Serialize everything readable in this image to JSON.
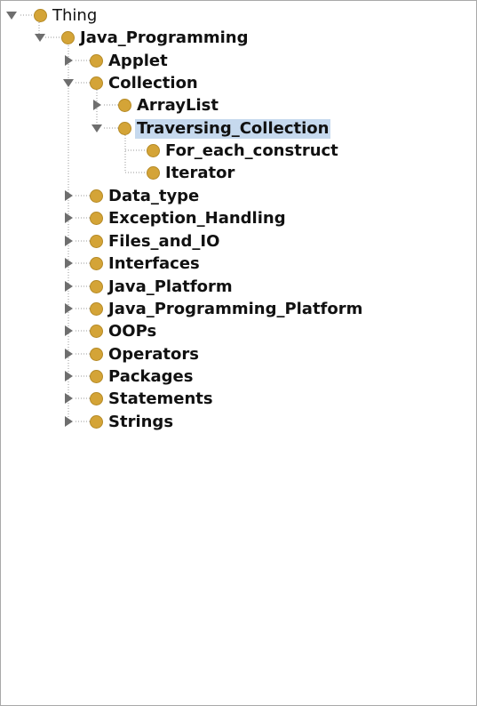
{
  "colors": {
    "class_bullet": "#d4a437",
    "selection_highlight": "#c6d9ee",
    "toggle_arrow": "#6e6e6e",
    "tree_line": "#9a9a9a"
  },
  "tree": {
    "root": {
      "label": "Thing",
      "state": "expanded",
      "icon": "class-bullet-icon"
    },
    "java_programming": {
      "label": "Java_Programming",
      "state": "expanded",
      "icon": "class-bullet-icon"
    },
    "applet": {
      "label": "Applet",
      "state": "collapsed",
      "icon": "class-bullet-icon"
    },
    "collection": {
      "label": "Collection",
      "state": "expanded",
      "icon": "class-bullet-icon"
    },
    "arraylist": {
      "label": "ArrayList",
      "state": "collapsed",
      "icon": "class-bullet-icon"
    },
    "traversing_collection": {
      "label": "Traversing_Collection",
      "state": "expanded",
      "selected": true,
      "icon": "class-bullet-icon"
    },
    "for_each_construct": {
      "label": "For_each_construct",
      "state": "leaf",
      "icon": "class-bullet-icon"
    },
    "iterator": {
      "label": "Iterator",
      "state": "leaf",
      "icon": "class-bullet-icon"
    },
    "data_type": {
      "label": "Data_type",
      "state": "collapsed",
      "icon": "class-bullet-icon"
    },
    "exception_handling": {
      "label": "Exception_Handling",
      "state": "collapsed",
      "icon": "class-bullet-icon"
    },
    "files_and_io": {
      "label": "Files_and_IO",
      "state": "collapsed",
      "icon": "class-bullet-icon"
    },
    "interfaces": {
      "label": "Interfaces",
      "state": "collapsed",
      "icon": "class-bullet-icon"
    },
    "java_platform": {
      "label": "Java_Platform",
      "state": "collapsed",
      "icon": "class-bullet-icon"
    },
    "java_programming_platform": {
      "label": "Java_Programming_Platform",
      "state": "collapsed",
      "icon": "class-bullet-icon"
    },
    "oops": {
      "label": "OOPs",
      "state": "collapsed",
      "icon": "class-bullet-icon"
    },
    "operators": {
      "label": "Operators",
      "state": "collapsed",
      "icon": "class-bullet-icon"
    },
    "packages": {
      "label": "Packages",
      "state": "collapsed",
      "icon": "class-bullet-icon"
    },
    "statements": {
      "label": "Statements",
      "state": "collapsed",
      "icon": "class-bullet-icon"
    },
    "strings": {
      "label": "Strings",
      "state": "collapsed",
      "icon": "class-bullet-icon"
    }
  }
}
